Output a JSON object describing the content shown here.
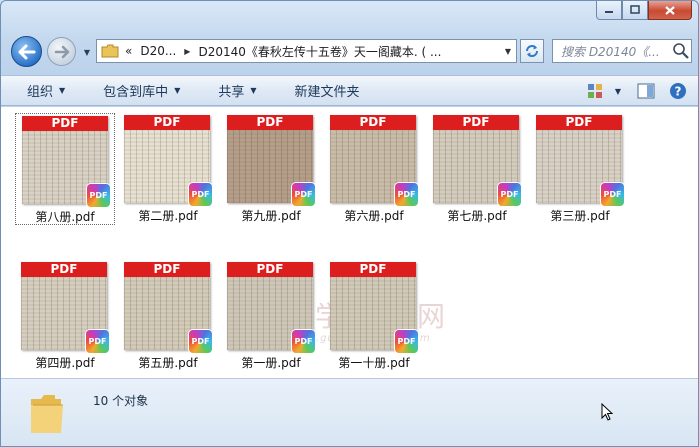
{
  "window": {
    "caption_buttons": [
      "minimize",
      "maximize",
      "close"
    ]
  },
  "address_bar": {
    "overflow": "«",
    "crumb1": "D20...",
    "crumb2": "D20140《春秋左传十五卷》天一阁藏本. ( ..."
  },
  "search": {
    "placeholder": "搜索 D20140《..."
  },
  "toolbar": {
    "organize": "组织",
    "include_library": "包含到库中",
    "share": "共享",
    "new_folder": "新建文件夹"
  },
  "files": [
    {
      "name": "第八册.pdf",
      "badge": "PDF",
      "band": "PDF",
      "tone": "#d9d3c6",
      "selected": true
    },
    {
      "name": "第二册.pdf",
      "badge": "PDF",
      "band": "PDF",
      "tone": "#e7e1d2"
    },
    {
      "name": "第九册.pdf",
      "badge": "PDF",
      "band": "PDF",
      "tone": "#b59f8a"
    },
    {
      "name": "第六册.pdf",
      "badge": "PDF",
      "band": "PDF",
      "tone": "#c9bdaa"
    },
    {
      "name": "第七册.pdf",
      "badge": "PDF",
      "band": "PDF",
      "tone": "#d4ccbd"
    },
    {
      "name": "第三册.pdf",
      "badge": "PDF",
      "band": "PDF",
      "tone": "#d8d2c6"
    },
    {
      "name": "第四册.pdf",
      "badge": "PDF",
      "band": "PDF",
      "tone": "#d6cfbf"
    },
    {
      "name": "第五册.pdf",
      "badge": "PDF",
      "band": "PDF",
      "tone": "#d3ccba"
    },
    {
      "name": "第一册.pdf",
      "badge": "PDF",
      "band": "PDF",
      "tone": "#cfc8b8"
    },
    {
      "name": "第一十册.pdf",
      "badge": "PDF",
      "band": "PDF",
      "tone": "#d2cab9"
    }
  ],
  "status": {
    "count_text": "10 个对象"
  },
  "watermark": {
    "text": "国学资源网",
    "url": "www.guoxueziyuan.com",
    "seal": "德"
  },
  "colors": {
    "pdf_red": "#dd1e1f",
    "toolbar_text": "#1e395b",
    "selection_border": "#6a6a6a"
  }
}
